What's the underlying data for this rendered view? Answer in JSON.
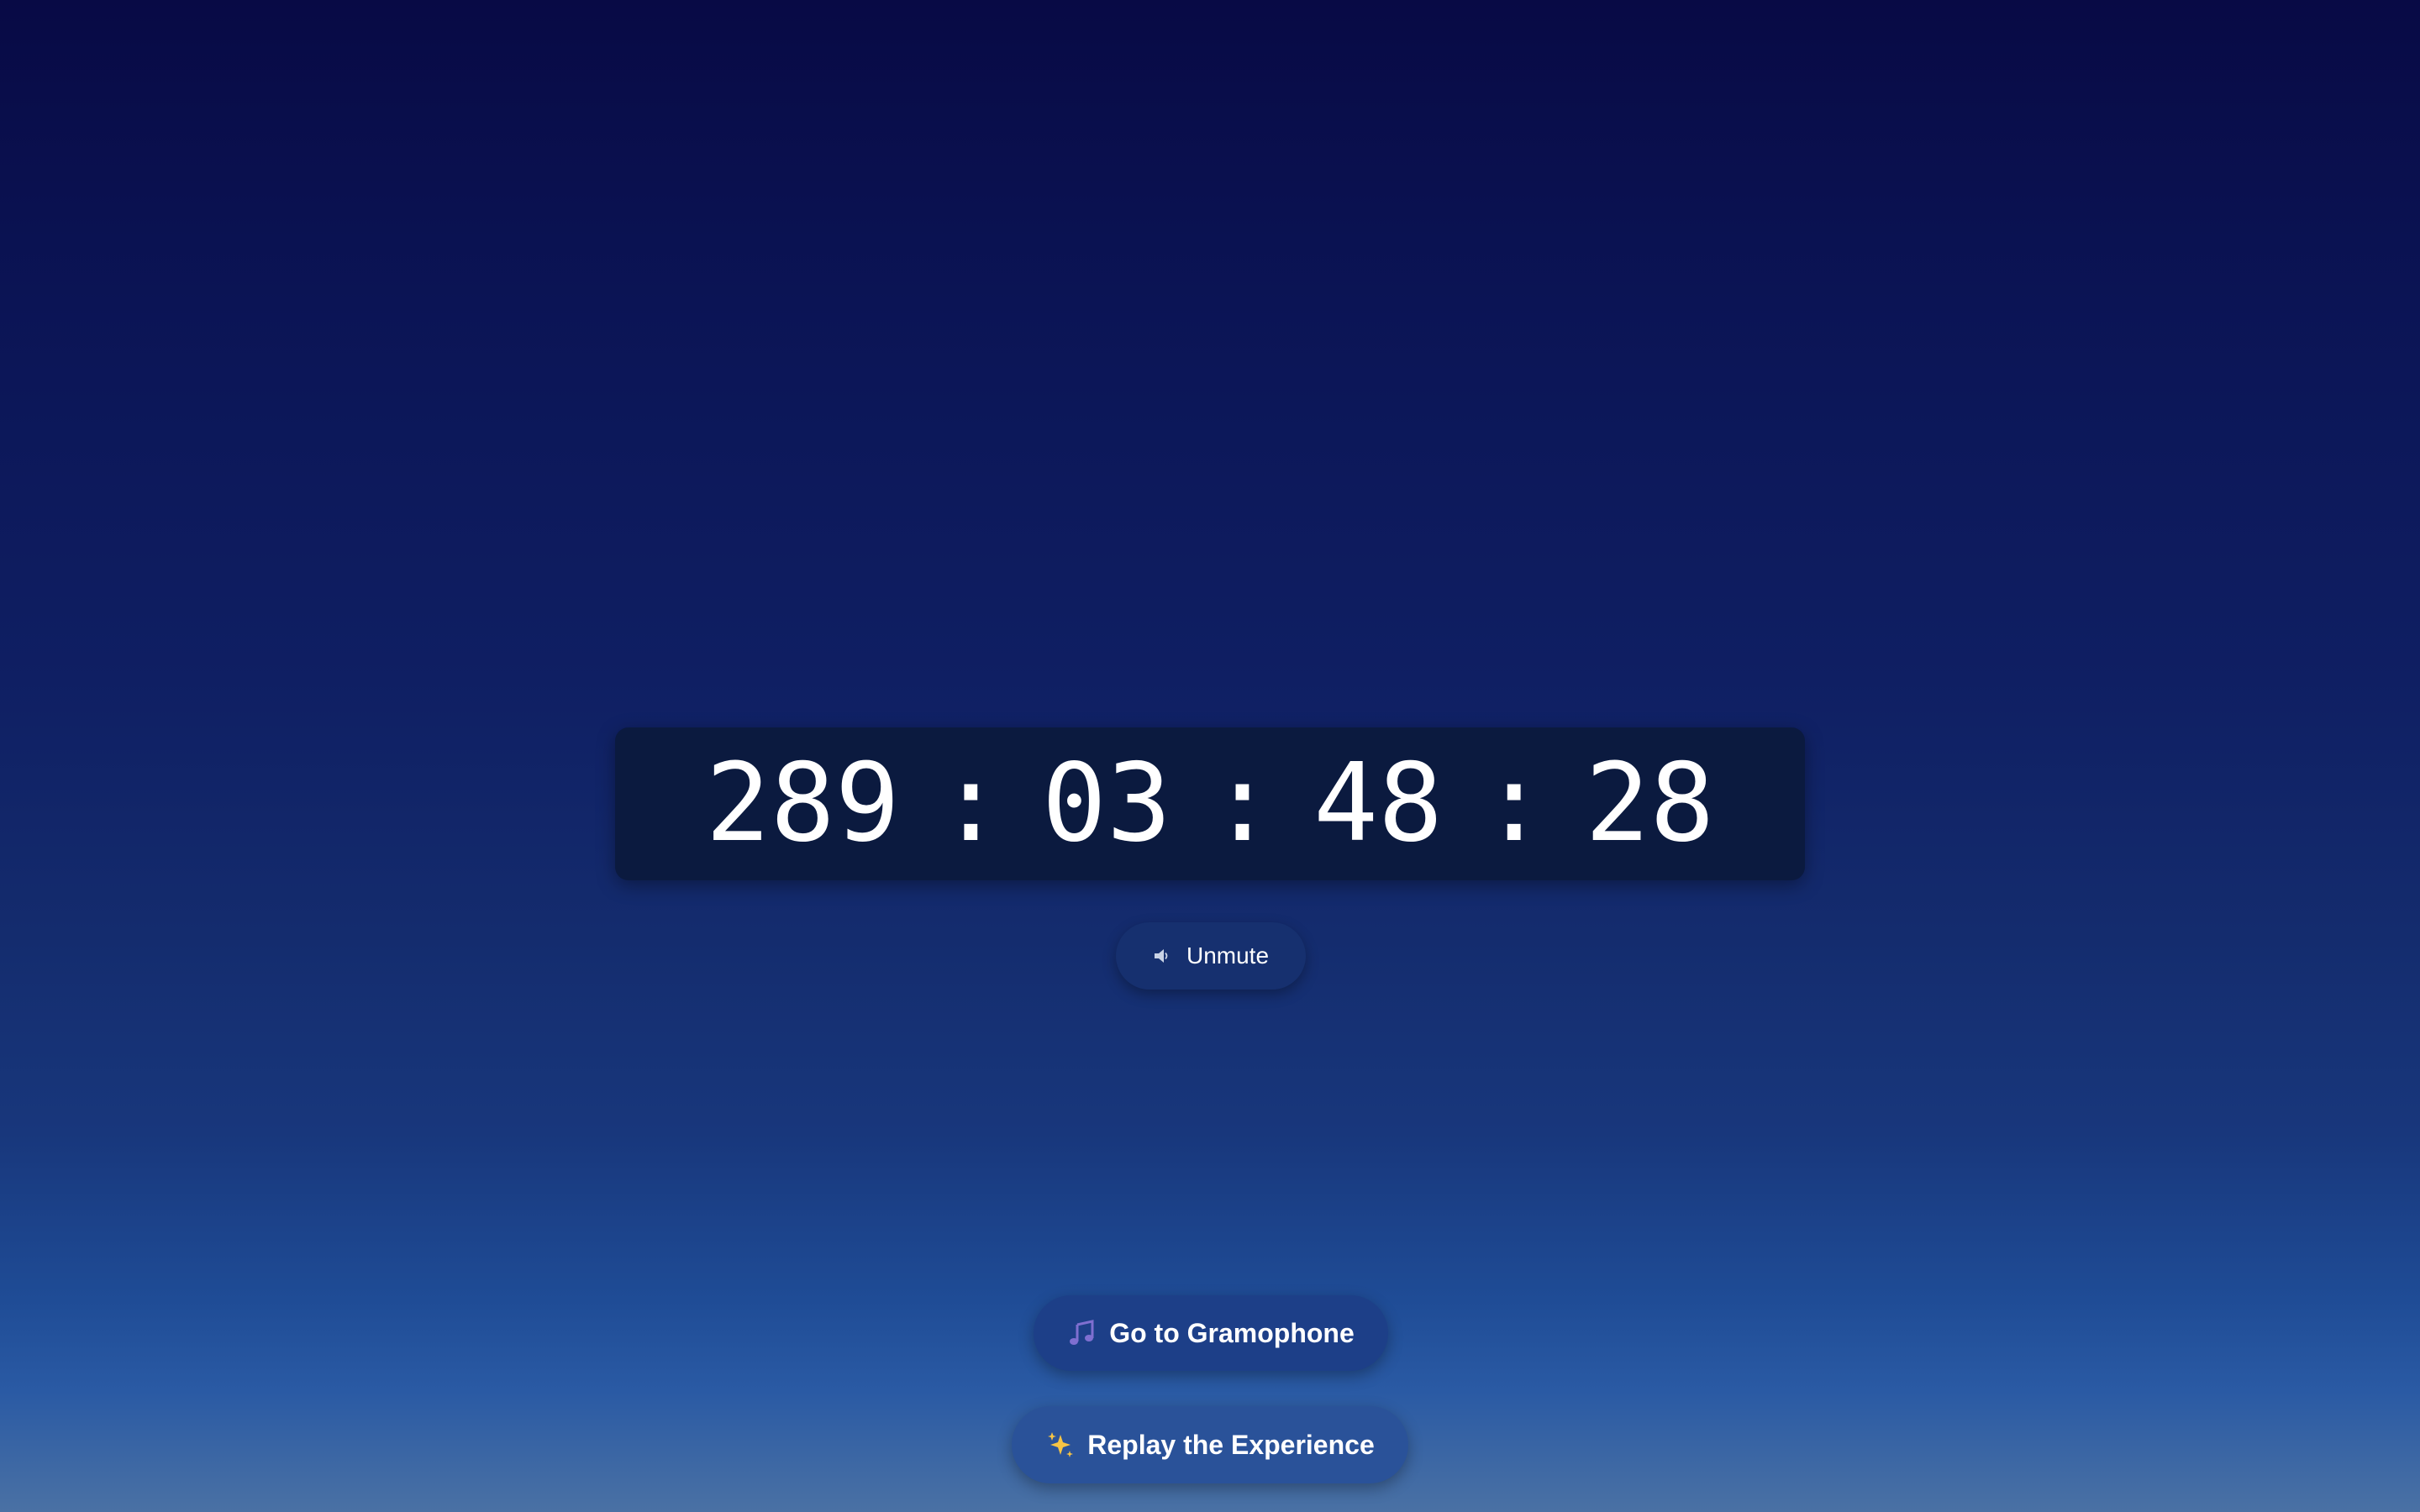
{
  "countdown": {
    "days": "289",
    "hours": "03",
    "minutes": "48",
    "seconds": "28",
    "separator": ":"
  },
  "unmute_button": {
    "label": "Unmute",
    "icon": "speaker-icon"
  },
  "gramophone_button": {
    "label": "Go to Gramophone",
    "icon": "music-note-icon"
  },
  "replay_button": {
    "label": "Replay the Experience",
    "icon": "sparkles-icon"
  },
  "colors": {
    "background_top": "#080a45",
    "background_bottom": "#4a71a4",
    "countdown_panel": "#0b1a3f",
    "text": "#ffffff"
  }
}
